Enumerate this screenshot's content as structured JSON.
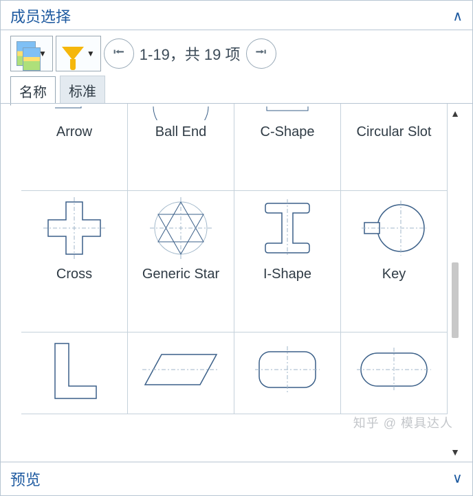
{
  "header": {
    "title": "成员选择"
  },
  "pager": {
    "text": "1-19，共 19 项"
  },
  "tabs": {
    "name": "名称",
    "standard": "标准"
  },
  "preview": {
    "title": "预览"
  },
  "items": [
    {
      "label": "Arrow"
    },
    {
      "label": "Ball End"
    },
    {
      "label": "C-Shape"
    },
    {
      "label": "Circular Slot"
    },
    {
      "label": "Cross"
    },
    {
      "label": "Generic Star"
    },
    {
      "label": "I-Shape"
    },
    {
      "label": "Key"
    }
  ],
  "watermark": "知乎 @ 模具达人"
}
